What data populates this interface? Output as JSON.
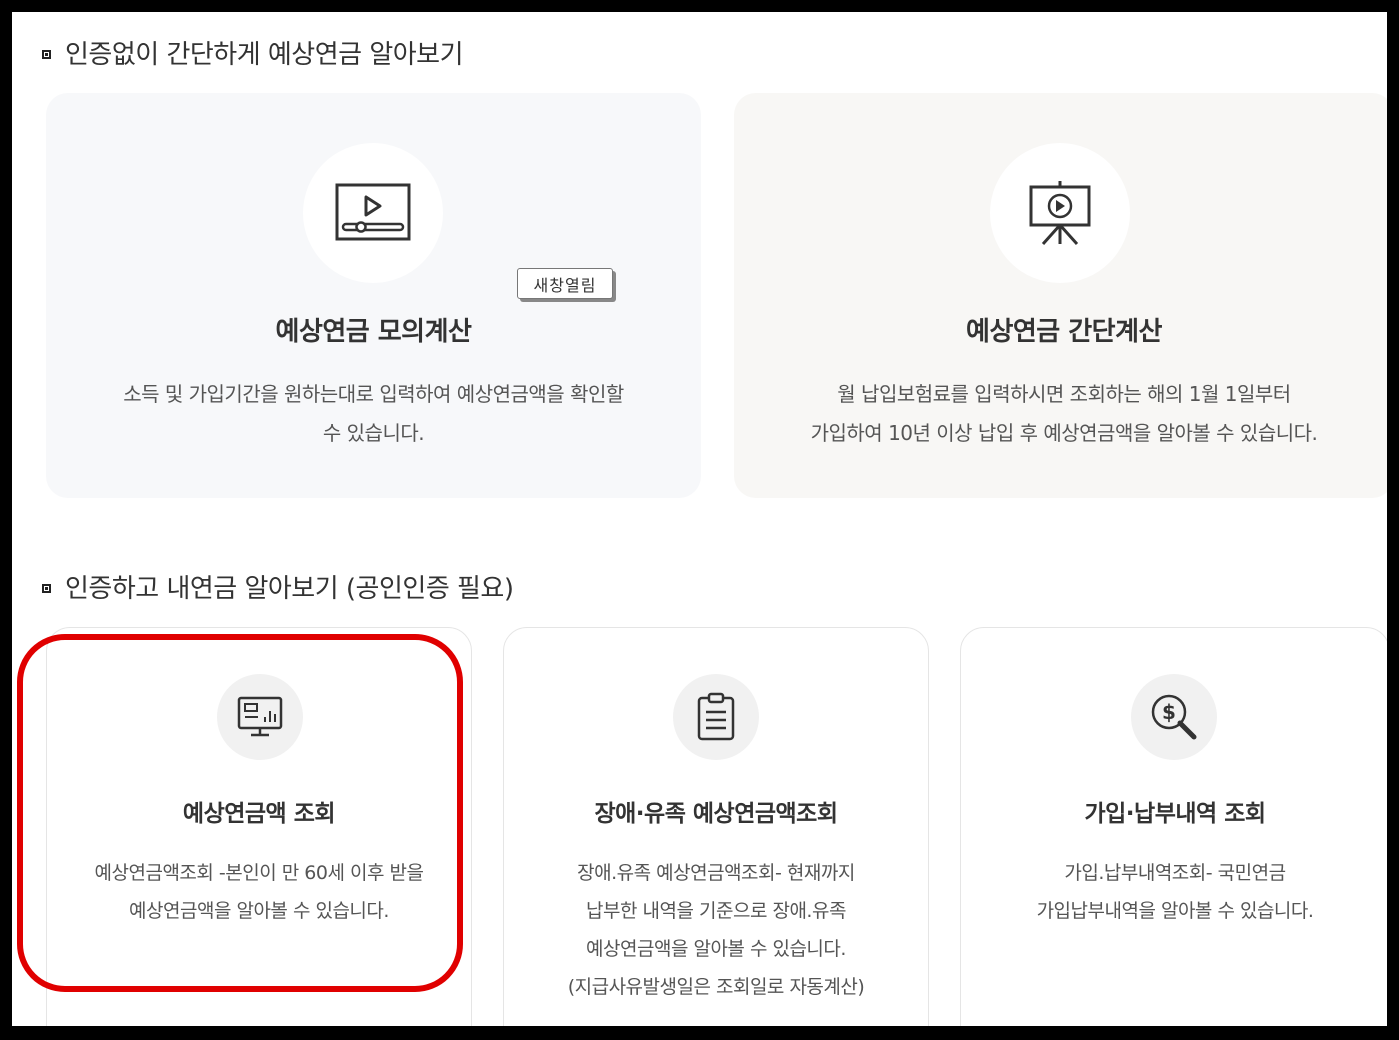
{
  "section1": {
    "title": "인증없이 간단하게 예상연금 알아보기"
  },
  "cards_top": [
    {
      "icon": "video-player-icon",
      "badge": "새창열림",
      "title": "예상연금 모의계산",
      "desc_line1": "소득 및 가입기간을 원하는대로 입력하여 예상연금액을 확인할",
      "desc_line2": "수 있습니다."
    },
    {
      "icon": "presentation-board-icon",
      "title": "예상연금 간단계산",
      "desc_line1": "월 납입보험료를 입력하시면 조회하는 해의 1월 1일부터",
      "desc_line2": "가입하여 10년 이상 납입 후 예상연금액을 알아볼 수 있습니다."
    }
  ],
  "section2": {
    "title": "인증하고 내연금 알아보기 (공인인증 필요)"
  },
  "cards_bottom": [
    {
      "icon": "monitor-chart-icon",
      "title": "예상연금액 조회",
      "desc_line1": "예상연금액조회 -본인이 만 60세 이후 받을",
      "desc_line2": "예상연금액을 알아볼 수 있습니다."
    },
    {
      "icon": "clipboard-list-icon",
      "title": "장애·유족 예상연금액조회",
      "desc_line1": "장애.유족 예상연금액조회- 현재까지",
      "desc_line2": "납부한 내역을 기준으로 장애.유족",
      "desc_line3": "예상연금액을 알아볼 수 있습니다.",
      "desc_line4": "(지급사유발생일은 조회일로 자동계산)"
    },
    {
      "icon": "dollar-search-icon",
      "title": "가입·납부내역 조회",
      "desc_line1": "가입.납부내역조회- 국민연금",
      "desc_line2": "가입납부내역을 알아볼 수 있습니다."
    }
  ],
  "colors": {
    "highlight": "#e00000",
    "text": "#333333",
    "card_bg": "#f7f8fa"
  }
}
